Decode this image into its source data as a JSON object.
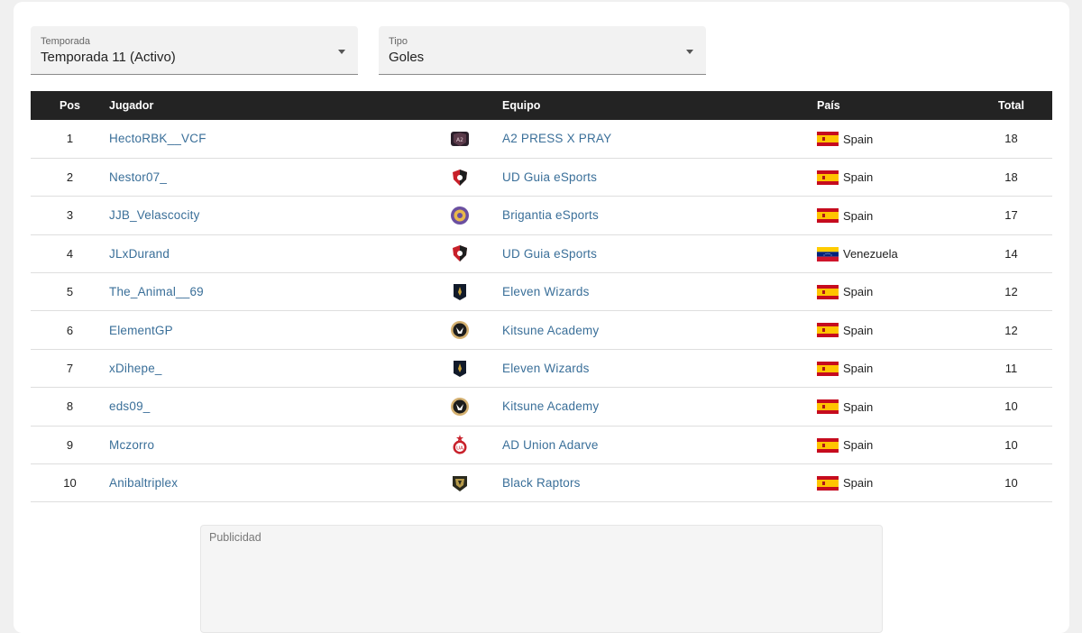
{
  "filters": {
    "season": {
      "label": "Temporada",
      "value": "Temporada 11 (Activo)"
    },
    "type": {
      "label": "Tipo",
      "value": "Goles"
    }
  },
  "table": {
    "headers": {
      "pos": "Pos",
      "player": "Jugador",
      "team": "Equipo",
      "country": "País",
      "total": "Total"
    },
    "rows": [
      {
        "pos": "1",
        "player": "HectoRBK__VCF",
        "team": "A2 PRESS X PRAY",
        "team_logo": "a2-press-x-pray-logo",
        "country": "Spain",
        "flag": "spain-flag-icon",
        "total": "18"
      },
      {
        "pos": "2",
        "player": "Nestor07_",
        "team": "UD Guia eSports",
        "team_logo": "ud-guia-logo",
        "country": "Spain",
        "flag": "spain-flag-icon",
        "total": "18"
      },
      {
        "pos": "3",
        "player": "JJB_Velascocity",
        "team": "Brigantia eSports",
        "team_logo": "brigantia-logo",
        "country": "Spain",
        "flag": "spain-flag-icon",
        "total": "17"
      },
      {
        "pos": "4",
        "player": "JLxDurand",
        "team": "UD Guia eSports",
        "team_logo": "ud-guia-logo",
        "country": "Venezuela",
        "flag": "venezuela-flag-icon",
        "total": "14"
      },
      {
        "pos": "5",
        "player": "The_Animal__69",
        "team": "Eleven Wizards",
        "team_logo": "eleven-wizards-logo",
        "country": "Spain",
        "flag": "spain-flag-icon",
        "total": "12"
      },
      {
        "pos": "6",
        "player": "ElementGP",
        "team": "Kitsune Academy",
        "team_logo": "kitsune-logo",
        "country": "Spain",
        "flag": "spain-flag-icon",
        "total": "12"
      },
      {
        "pos": "7",
        "player": "xDihepe_",
        "team": "Eleven Wizards",
        "team_logo": "eleven-wizards-logo",
        "country": "Spain",
        "flag": "spain-flag-icon",
        "total": "11"
      },
      {
        "pos": "8",
        "player": "eds09_",
        "team": "Kitsune Academy",
        "team_logo": "kitsune-logo",
        "country": "Spain",
        "flag": "spain-flag-icon",
        "total": "10"
      },
      {
        "pos": "9",
        "player": "Mczorro",
        "team": "AD Union Adarve",
        "team_logo": "union-adarve-logo",
        "country": "Spain",
        "flag": "spain-flag-icon",
        "total": "10"
      },
      {
        "pos": "10",
        "player": "Anibaltriplex",
        "team": "Black Raptors",
        "team_logo": "black-raptors-logo",
        "country": "Spain",
        "flag": "spain-flag-icon",
        "total": "10"
      }
    ]
  },
  "ad": {
    "label": "Publicidad"
  },
  "colors": {
    "header_bg": "#232323",
    "link": "#3a6f99",
    "page_bg": "#f0f0f0"
  }
}
